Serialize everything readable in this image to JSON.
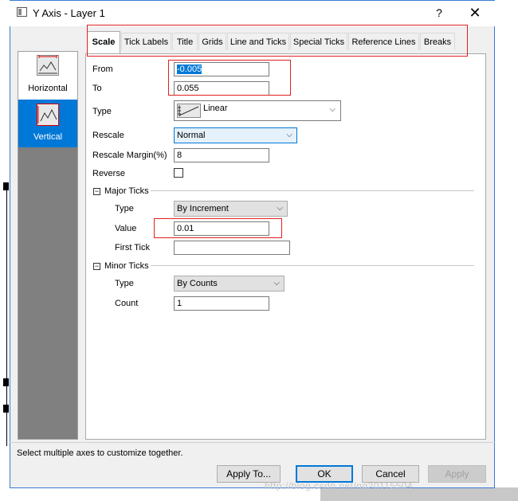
{
  "window": {
    "title": "Y Axis - Layer 1",
    "help": "?",
    "close": "✕"
  },
  "axes": [
    {
      "label": "Horizontal",
      "selected": false
    },
    {
      "label": "Vertical",
      "selected": true
    }
  ],
  "tabs": [
    "Scale",
    "Tick Labels",
    "Title",
    "Grids",
    "Line and Ticks",
    "Special Ticks",
    "Reference Lines",
    "Breaks"
  ],
  "active_tab": "Scale",
  "scale": {
    "from_label": "From",
    "from_value": "-0.005",
    "to_label": "To",
    "to_value": "0.055",
    "type_label": "Type",
    "type_value": "Linear",
    "rescale_label": "Rescale",
    "rescale_value": "Normal",
    "rescale_margin_label": "Rescale Margin(%)",
    "rescale_margin_value": "8",
    "reverse_label": "Reverse",
    "reverse_checked": false
  },
  "major_ticks": {
    "heading": "Major Ticks",
    "type_label": "Type",
    "type_value": "By Increment",
    "value_label": "Value",
    "value_value": "0.01",
    "first_tick_label": "First Tick",
    "first_tick_value": ""
  },
  "minor_ticks": {
    "heading": "Minor Ticks",
    "type_label": "Type",
    "type_value": "By Counts",
    "count_label": "Count",
    "count_value": "1"
  },
  "status_text": "Select multiple axes to customize together.",
  "buttons": {
    "apply_to": "Apply To...",
    "ok": "OK",
    "cancel": "Cancel",
    "apply": "Apply"
  },
  "watermark": "http://blog.csdn.net/qq20115504",
  "colors": {
    "accent": "#0078d7",
    "annotation": "#e02020"
  }
}
